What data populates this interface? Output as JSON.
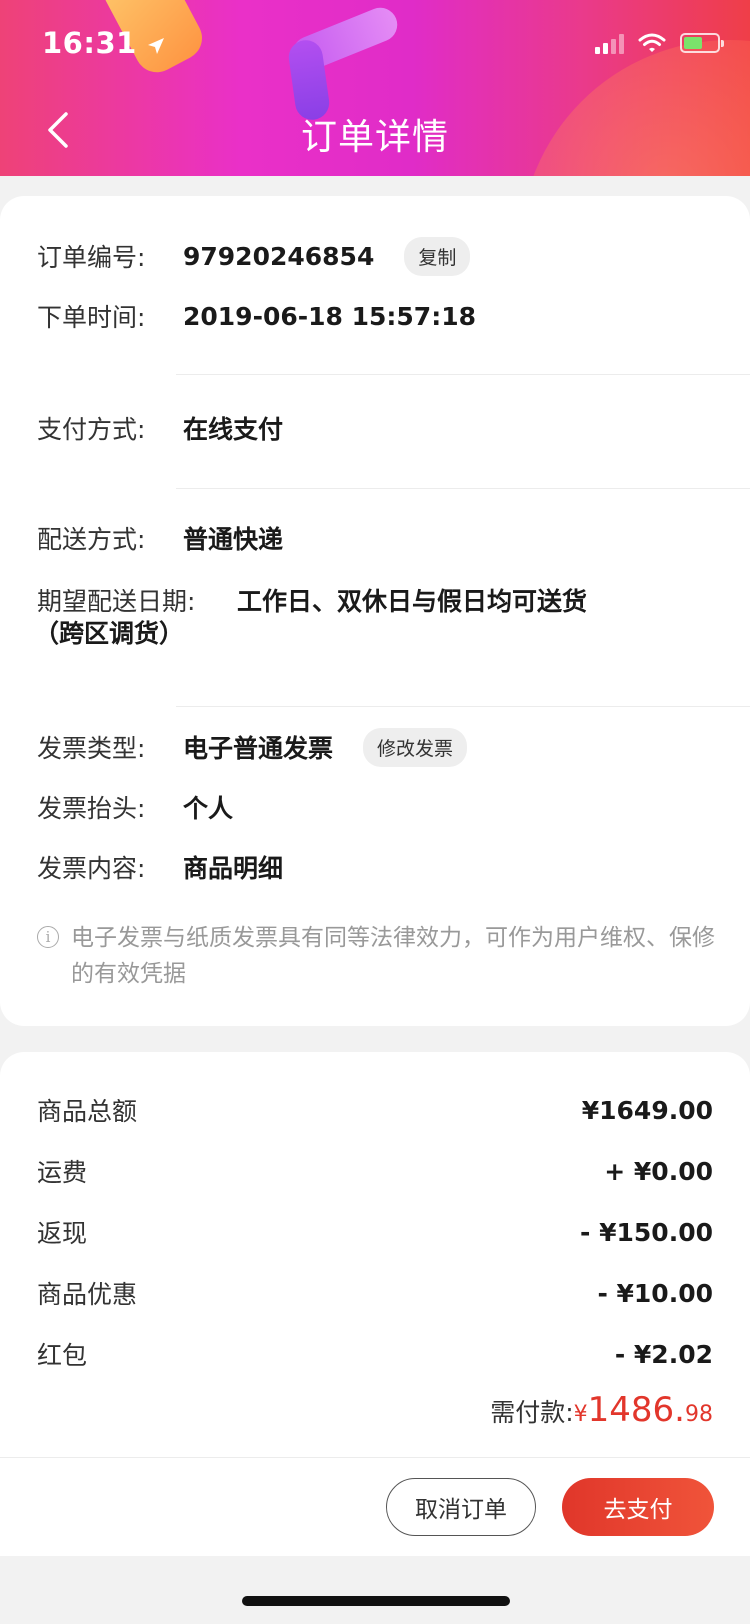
{
  "status_bar": {
    "time": "16:31"
  },
  "header": {
    "title": "订单详情"
  },
  "order_info": {
    "order_no_label": "订单编号:",
    "order_no": "97920246854",
    "copy_label": "复制",
    "order_time_label": "下单时间:",
    "order_time": "2019-06-18 15:57:18",
    "payment_label": "支付方式:",
    "payment": "在线支付",
    "delivery_label": "配送方式:",
    "delivery": "普通快递",
    "expected_label": "期望配送日期:",
    "expected": "工作日、双休日与假日均可送货",
    "expected_note": "（跨区调货）",
    "invoice_type_label": "发票类型:",
    "invoice_type": "电子普通发票",
    "edit_invoice_label": "修改发票",
    "invoice_title_label": "发票抬头:",
    "invoice_title": "个人",
    "invoice_content_label": "发票内容:",
    "invoice_content": "商品明细",
    "invoice_note": "电子发票与纸质发票具有同等法律效力，可作为用户维权、保修的有效凭据"
  },
  "amounts": {
    "rows": [
      {
        "label": "商品总额",
        "value": "¥1649.00"
      },
      {
        "label": "运费",
        "value": "+ ¥0.00"
      },
      {
        "label": "返现",
        "value": "- ¥150.00"
      },
      {
        "label": "商品优惠",
        "value": "- ¥10.00"
      },
      {
        "label": "红包",
        "value": "- ¥2.02"
      }
    ],
    "payable_label": "需付款:",
    "payable_currency": "¥",
    "payable_int": "1486.",
    "payable_dec": "98"
  },
  "actions": {
    "cancel_label": "取消订单",
    "pay_label": "去支付"
  },
  "colors": {
    "accent_red": "#e2362b",
    "header_pink": "#e02cc8"
  }
}
